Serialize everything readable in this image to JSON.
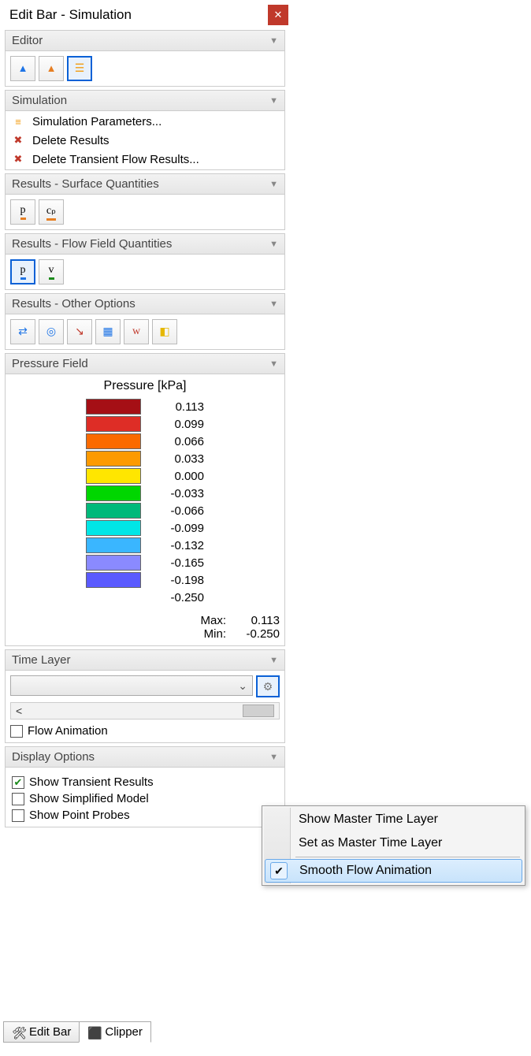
{
  "title": "Edit Bar - Simulation",
  "sections": {
    "editor": {
      "title": "Editor"
    },
    "simulation": {
      "title": "Simulation",
      "items": [
        "Simulation Parameters...",
        "Delete Results",
        "Delete Transient Flow Results..."
      ]
    },
    "surface": {
      "title": "Results - Surface Quantities"
    },
    "flowfield": {
      "title": "Results - Flow Field Quantities"
    },
    "other": {
      "title": "Results - Other Options"
    },
    "pressure": {
      "title": "Pressure Field",
      "legend_title": "Pressure [kPa]",
      "bands": [
        {
          "color": "#a50f15",
          "value": "0.113"
        },
        {
          "color": "#de2d26",
          "value": "0.099"
        },
        {
          "color": "#fb6a00",
          "value": "0.066"
        },
        {
          "color": "#fd9a00",
          "value": "0.033"
        },
        {
          "color": "#ffe600",
          "value": "0.000"
        },
        {
          "color": "#00d600",
          "value": "-0.033"
        },
        {
          "color": "#00b97a",
          "value": "-0.066"
        },
        {
          "color": "#00e6e6",
          "value": "-0.099"
        },
        {
          "color": "#3ab6ff",
          "value": "-0.132"
        },
        {
          "color": "#8a8aff",
          "value": "-0.165"
        },
        {
          "color": "#5a5aff",
          "value": "-0.198"
        },
        {
          "color": "#0000d6",
          "value": "-0.250"
        }
      ],
      "max_label": "Max:",
      "max_value": "0.113",
      "min_label": "Min:",
      "min_value": "-0.250"
    },
    "timelayer": {
      "title": "Time Layer",
      "flow_anim": "Flow Animation"
    },
    "display": {
      "title": "Display Options",
      "opts": [
        {
          "label": "Show Transient Results",
          "checked": true
        },
        {
          "label": "Show Simplified Model",
          "checked": false
        },
        {
          "label": "Show Point Probes",
          "checked": false
        }
      ]
    }
  },
  "popup": {
    "items": [
      "Show Master Time Layer",
      "Set as Master Time Layer",
      "Smooth Flow Animation"
    ]
  },
  "tabs": {
    "edit": "Edit Bar",
    "clipper": "Clipper"
  },
  "glyphs": {
    "p": "p",
    "cp": "cₚ",
    "v": "v",
    "w": "w",
    "arrow_left": "<"
  }
}
